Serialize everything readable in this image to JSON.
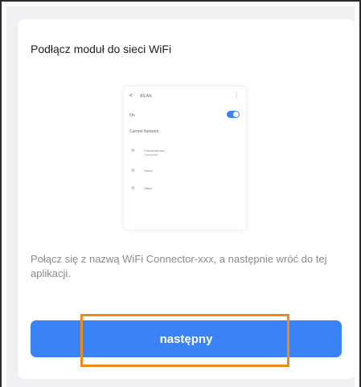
{
  "card": {
    "title": "Podłącz moduł do sieci WiFi",
    "instruction": "Połącz się z nazwą WiFi Connector-xxx, a następnie wróć do tej aplikacji."
  },
  "preview": {
    "back_glyph": "<",
    "screen_title": "WLAN",
    "more_glyph": "⋮",
    "on_label": "On",
    "toggle_on": true,
    "section_label": "Current Network",
    "networks": [
      {
        "name": "Connector-xxx",
        "sub": "Connected"
      },
      {
        "name": "Home",
        "sub": ""
      },
      {
        "name": "Office",
        "sub": ""
      }
    ],
    "wifi_icon": "wifi-icon"
  },
  "actions": {
    "next_label": "następny"
  },
  "colors": {
    "accent": "#3b82f6",
    "highlight": "#ec8a1c",
    "panel_bg": "#eef0f4",
    "instruction_text": "#8a8a8a"
  }
}
